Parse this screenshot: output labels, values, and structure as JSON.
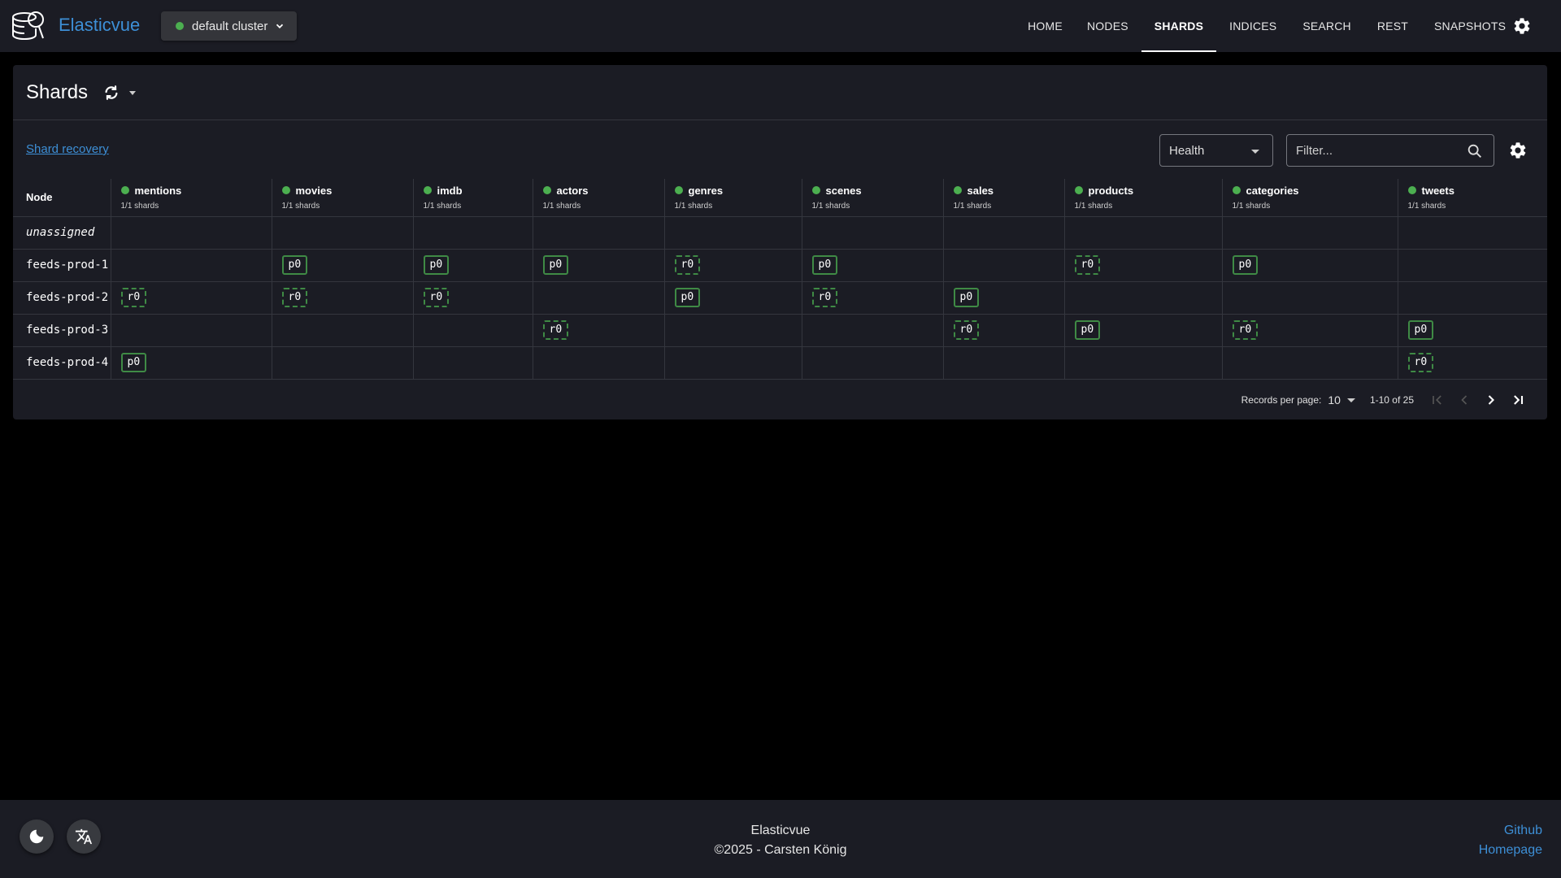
{
  "app": {
    "brand": "Elasticvue",
    "cluster": {
      "name": "default cluster",
      "status_color": "#4caf50"
    }
  },
  "nav": {
    "items": [
      {
        "label": "HOME",
        "active": false
      },
      {
        "label": "NODES",
        "active": false
      },
      {
        "label": "SHARDS",
        "active": true
      },
      {
        "label": "INDICES",
        "active": false
      },
      {
        "label": "SEARCH",
        "active": false
      },
      {
        "label": "REST",
        "active": false
      },
      {
        "label": "SNAPSHOTS",
        "active": false
      }
    ],
    "settings_icon": "gear-icon"
  },
  "page": {
    "title": "Shards",
    "reload_icon": "refresh-icon",
    "shard_recovery_link": "Shard recovery",
    "health_select": {
      "value": "Health"
    },
    "filter": {
      "placeholder": "Filter...",
      "value": ""
    }
  },
  "table": {
    "node_header": "Node",
    "indices": [
      {
        "name": "mentions",
        "health": "green",
        "shards": "1/1 shards"
      },
      {
        "name": "movies",
        "health": "green",
        "shards": "1/1 shards"
      },
      {
        "name": "imdb",
        "health": "green",
        "shards": "1/1 shards"
      },
      {
        "name": "actors",
        "health": "green",
        "shards": "1/1 shards"
      },
      {
        "name": "genres",
        "health": "green",
        "shards": "1/1 shards"
      },
      {
        "name": "scenes",
        "health": "green",
        "shards": "1/1 shards"
      },
      {
        "name": "sales",
        "health": "green",
        "shards": "1/1 shards"
      },
      {
        "name": "products",
        "health": "green",
        "shards": "1/1 shards"
      },
      {
        "name": "categories",
        "health": "green",
        "shards": "1/1 shards"
      },
      {
        "name": "tweets",
        "health": "green",
        "shards": "1/1 shards"
      }
    ],
    "rows": [
      {
        "node": "unassigned",
        "unassigned": true,
        "cells": [
          "",
          "",
          "",
          "",
          "",
          "",
          "",
          "",
          "",
          ""
        ]
      },
      {
        "node": "feeds-prod-1",
        "cells": [
          "",
          "p0",
          "p0",
          "p0",
          "r0",
          "p0",
          "",
          "r0",
          "p0",
          ""
        ]
      },
      {
        "node": "feeds-prod-2",
        "cells": [
          "r0",
          "r0",
          "r0",
          "",
          "p0",
          "r0",
          "p0",
          "",
          "",
          ""
        ]
      },
      {
        "node": "feeds-prod-3",
        "cells": [
          "",
          "",
          "",
          "r0",
          "",
          "",
          "r0",
          "p0",
          "r0",
          "p0"
        ]
      },
      {
        "node": "feeds-prod-4",
        "cells": [
          "p0",
          "",
          "",
          "",
          "",
          "",
          "",
          "",
          "",
          "r0"
        ]
      }
    ]
  },
  "pagination": {
    "records_per_page_label": "Records per page:",
    "records_per_page": "10",
    "range": "1-10 of 25"
  },
  "footer": {
    "title": "Elasticvue",
    "copyright": "©2025 - Carsten König",
    "links": [
      "Github",
      "Homepage"
    ]
  },
  "colors": {
    "accent": "#3d8fd6",
    "health_green": "#4caf50",
    "shard_border": "#3f8a45",
    "surface": "#1b1c24"
  }
}
